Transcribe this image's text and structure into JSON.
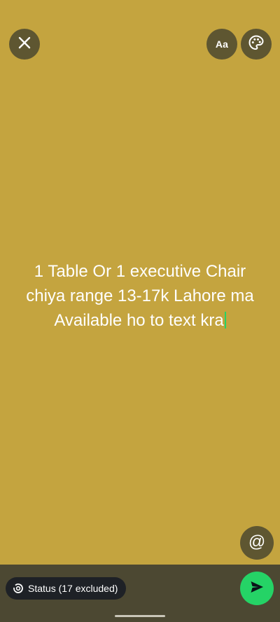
{
  "toolbar": {
    "close_icon": "close-icon",
    "font_label": "Aa",
    "palette_icon": "palette-icon"
  },
  "status": {
    "text": "1 Table Or 1 executive Chair chiya range 13-17k Lahore ma Available ho to text kra",
    "background_color": "#c4a43f",
    "caret_color": "#25d366"
  },
  "mention": {
    "glyph": "@"
  },
  "bottom_bar": {
    "audience_label": "Status (17 excluded)",
    "audience_icon": "status-ring-icon",
    "send_icon": "send-icon",
    "send_color": "#25d366"
  }
}
